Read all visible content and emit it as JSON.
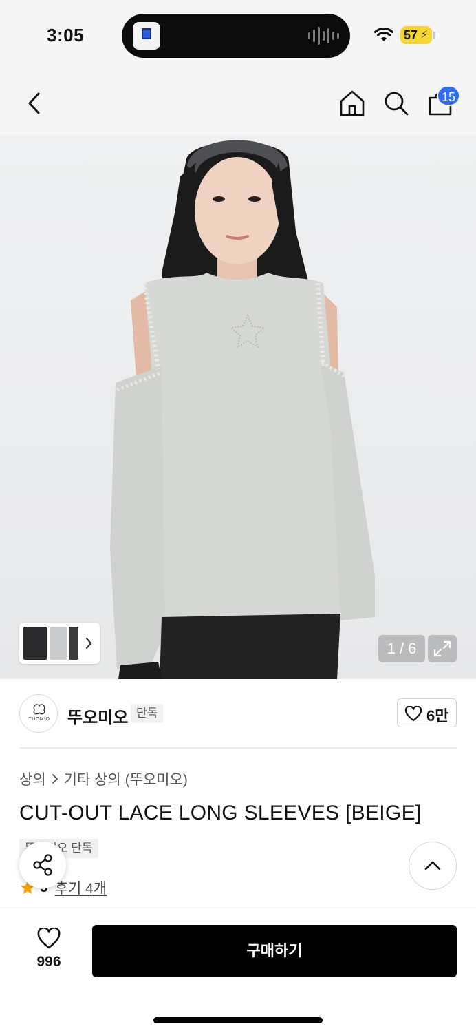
{
  "status_bar": {
    "time": "3:05",
    "battery": "57"
  },
  "header": {
    "cart_count": "15"
  },
  "gallery": {
    "counter": "1 / 6"
  },
  "brand": {
    "logo_text": "TUOMIO",
    "name": "뚜오미오",
    "tag": "단독",
    "likes": "6만"
  },
  "product": {
    "breadcrumb": [
      "상의",
      "기타 상의 (뚜오미오)"
    ],
    "title": "CUT-OUT LACE LONG SLEEVES [BEIGE]",
    "exclusive_tag": "뚜오미오 단독",
    "rating": "5",
    "review_link": "후기 4개"
  },
  "bottom_bar": {
    "wish_count": "996",
    "buy_label": "구매하기"
  },
  "colors": {
    "accent": "#2f6df6",
    "star": "#f5a30a",
    "buy_button": "#000000"
  }
}
